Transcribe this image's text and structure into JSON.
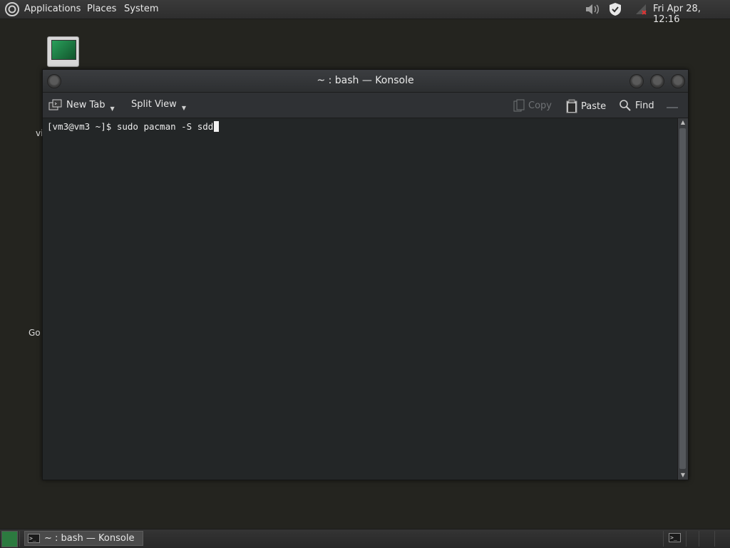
{
  "top_panel": {
    "menus": [
      "Applications",
      "Places",
      "System"
    ],
    "clock": "Fri Apr 28, 12:16"
  },
  "desktop": {
    "labels": [
      "vi",
      "Go"
    ]
  },
  "window": {
    "title": "~ : bash — Konsole",
    "toolbar": {
      "new_tab": "New Tab",
      "split_view": "Split View",
      "copy": "Copy",
      "paste": "Paste",
      "find": "Find"
    },
    "terminal": {
      "prompt": "[vm3@vm3 ~]$ ",
      "command": "sudo pacman -S sdd"
    }
  },
  "bottom_panel": {
    "task_title": "~ : bash — Konsole"
  },
  "icons": {
    "terminal_glyph": ">_"
  }
}
